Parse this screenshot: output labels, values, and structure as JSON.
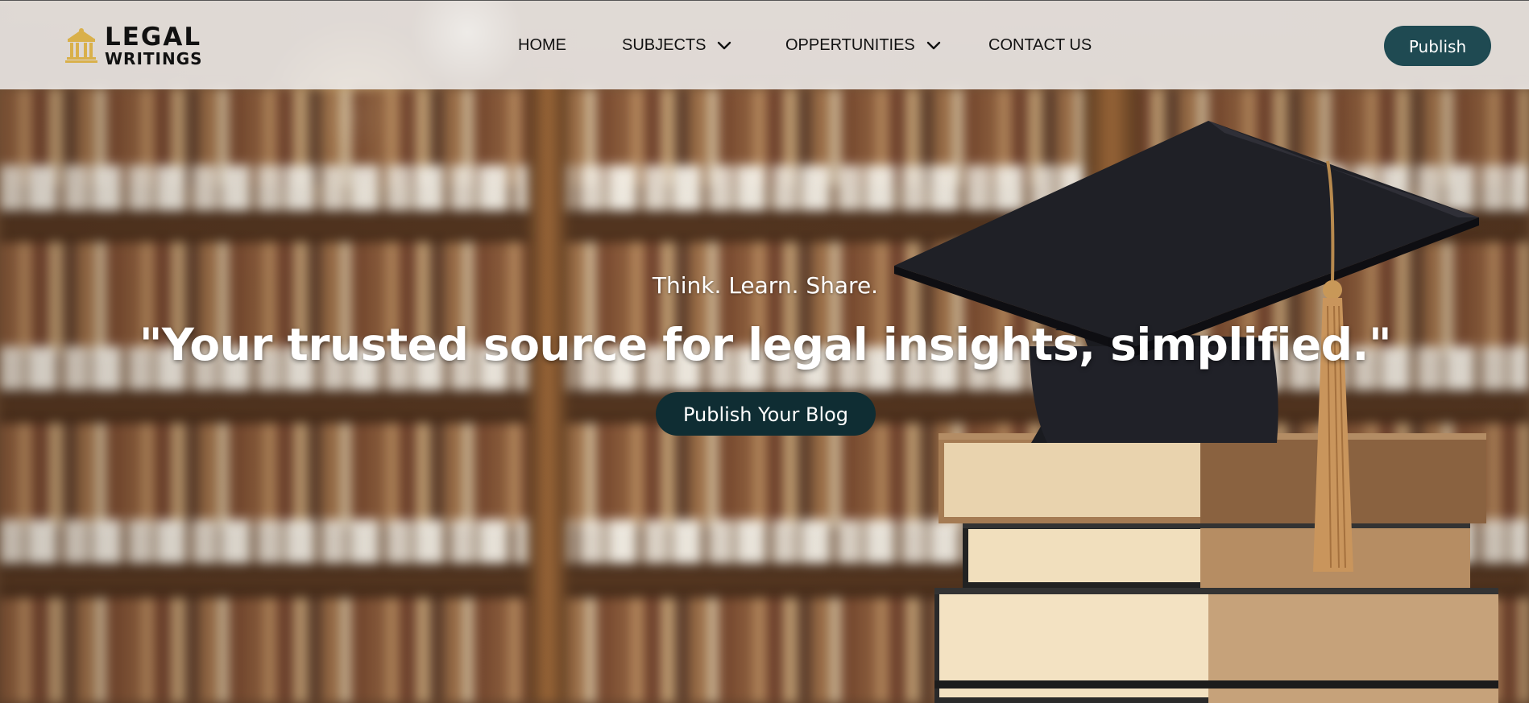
{
  "header": {
    "logo": {
      "line1": "LEGAL",
      "line2": "WRITINGS",
      "icon": "courthouse-icon"
    },
    "nav": [
      {
        "label": "HOME",
        "has_dropdown": false
      },
      {
        "label": "SUBJECTS",
        "has_dropdown": true
      },
      {
        "label": "OPPERTUNITIES",
        "has_dropdown": true
      },
      {
        "label": "CONTACT US",
        "has_dropdown": false
      }
    ],
    "publish_label": "Publish"
  },
  "hero": {
    "tagline": "Think. Learn. Share.",
    "title": "\"Your trusted source for legal insights, simplified.\"",
    "cta_label": "Publish Your Blog"
  },
  "colors": {
    "publish_button": "#1f4a52",
    "cta_button": "#0f2d33",
    "logo_gold": "#d9b04a",
    "header_bg": "#eeecea"
  }
}
